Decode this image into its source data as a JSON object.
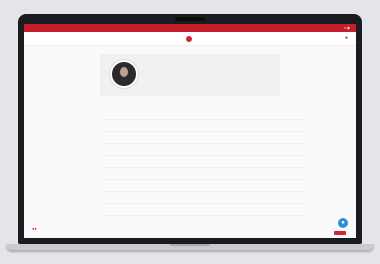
{
  "topbar": {
    "text": "",
    "icons": "≡ ◉"
  },
  "nav": {
    "items": [
      "",
      "",
      ""
    ],
    "logo_text": "",
    "items_right": [
      "",
      "",
      ""
    ],
    "right_icon": "●"
  },
  "profile": {
    "name": "",
    "sub": ""
  },
  "details": [
    {
      "label": "",
      "value": ""
    },
    {
      "label": "",
      "value": ""
    },
    {
      "label": "",
      "value": ""
    },
    {
      "label": "",
      "value": ""
    },
    {
      "label": "",
      "value": ""
    },
    {
      "label": "",
      "value": ""
    },
    {
      "label": "",
      "value": ""
    },
    {
      "label": "",
      "value": ""
    },
    {
      "label": "",
      "value": ""
    }
  ],
  "footer": {
    "left": "●●",
    "chat_icon": "●"
  },
  "colors": {
    "accent": "#c4202b",
    "chat": "#2f8fd6"
  }
}
